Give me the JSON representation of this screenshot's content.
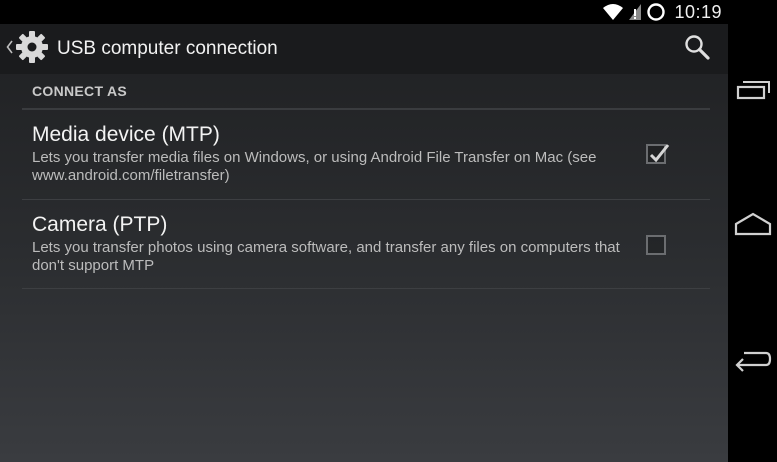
{
  "status_bar": {
    "time": "10:19",
    "icons": [
      "wifi-icon",
      "signal-icon",
      "sync-icon"
    ]
  },
  "action_bar": {
    "title": "USB computer connection",
    "app_icon": "settings-gear-icon",
    "up_icon": "chevron-left-icon",
    "search_icon": "search-icon"
  },
  "section": {
    "header": "CONNECT AS"
  },
  "preferences": [
    {
      "title": "Media device (MTP)",
      "summary": "Lets you transfer media files on Windows, or using Android File Transfer on Mac (see www.android.com/filetransfer)",
      "checked": true
    },
    {
      "title": "Camera (PTP)",
      "summary": "Lets you transfer photos using camera software, and transfer any files on computers that don't support MTP",
      "checked": false
    }
  ],
  "nav_bar": {
    "buttons": [
      "recent-apps-icon",
      "home-icon",
      "back-icon"
    ]
  },
  "colors": {
    "background": "#2b2d30",
    "action_bar": "#1a1b1d",
    "text_primary": "#f3f3f3",
    "text_secondary": "#bcbcbc"
  }
}
